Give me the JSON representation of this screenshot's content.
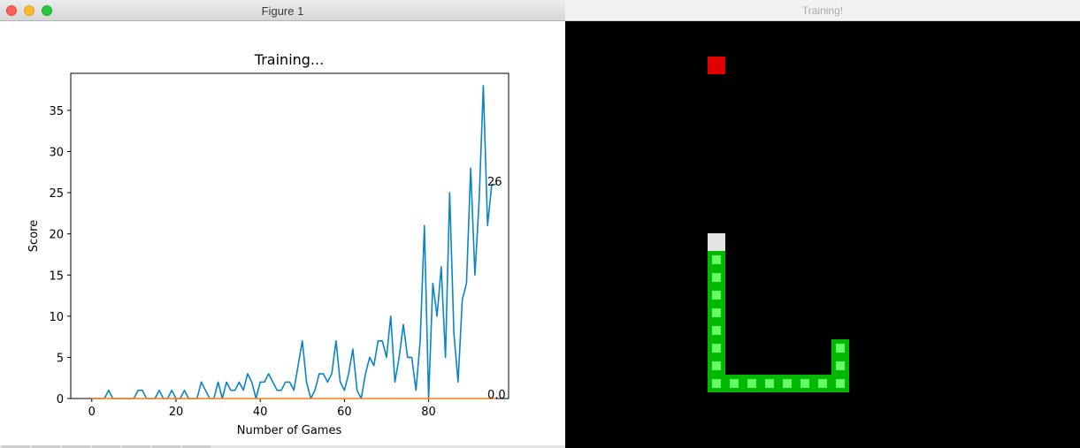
{
  "figure_window": {
    "title": "Figure 1"
  },
  "game_window": {
    "title": "Training!"
  },
  "chart_data": {
    "type": "line",
    "title": "Training...",
    "xlabel": "Number of Games",
    "ylabel": "Score",
    "xlim": [
      -5,
      99
    ],
    "ylim": [
      0,
      39.5
    ],
    "xticks": [
      0,
      20,
      40,
      60,
      80
    ],
    "yticks": [
      0,
      5,
      10,
      15,
      20,
      25,
      30,
      35
    ],
    "grid": false,
    "series": [
      {
        "color": "#0b84c7",
        "x": [
          0,
          1,
          2,
          3,
          4,
          5,
          6,
          7,
          8,
          9,
          10,
          11,
          12,
          13,
          14,
          15,
          16,
          17,
          18,
          19,
          20,
          21,
          22,
          23,
          24,
          25,
          26,
          27,
          28,
          29,
          30,
          31,
          32,
          33,
          34,
          35,
          36,
          37,
          38,
          39,
          40,
          41,
          42,
          43,
          44,
          45,
          46,
          47,
          48,
          49,
          50,
          51,
          52,
          53,
          54,
          55,
          56,
          57,
          58,
          59,
          60,
          61,
          62,
          63,
          64,
          65,
          66,
          67,
          68,
          69,
          70,
          71,
          72,
          73,
          74,
          75,
          76,
          77,
          78,
          79,
          80,
          81,
          82,
          83,
          84,
          85,
          86,
          87,
          88,
          89,
          90,
          91,
          92,
          93,
          94,
          95,
          96
        ],
        "values": [
          0,
          0,
          0,
          0,
          1,
          0,
          0,
          0,
          0,
          0,
          0,
          1,
          1,
          0,
          0,
          0,
          1,
          0,
          0,
          1,
          0,
          0,
          1,
          0,
          0,
          0,
          2,
          1,
          0,
          0,
          2,
          0,
          2,
          1,
          1,
          2,
          1,
          3,
          2,
          0,
          2,
          2,
          3,
          2,
          1,
          1,
          2,
          2,
          1,
          4,
          7,
          2,
          0,
          1,
          3,
          3,
          2,
          3,
          7,
          2,
          1,
          3,
          6,
          1,
          0,
          3,
          5,
          4,
          7,
          7,
          5,
          10,
          2,
          5,
          9,
          5,
          5,
          1,
          7,
          21,
          0,
          14,
          10,
          16,
          5,
          25,
          8,
          2,
          12,
          14,
          28,
          15,
          24,
          38,
          21,
          26,
          26
        ]
      },
      {
        "color": "#ff7f0e",
        "x": [
          0,
          96
        ],
        "values": [
          0,
          0
        ]
      }
    ],
    "end_labels": [
      "26",
      "0.0"
    ]
  }
}
